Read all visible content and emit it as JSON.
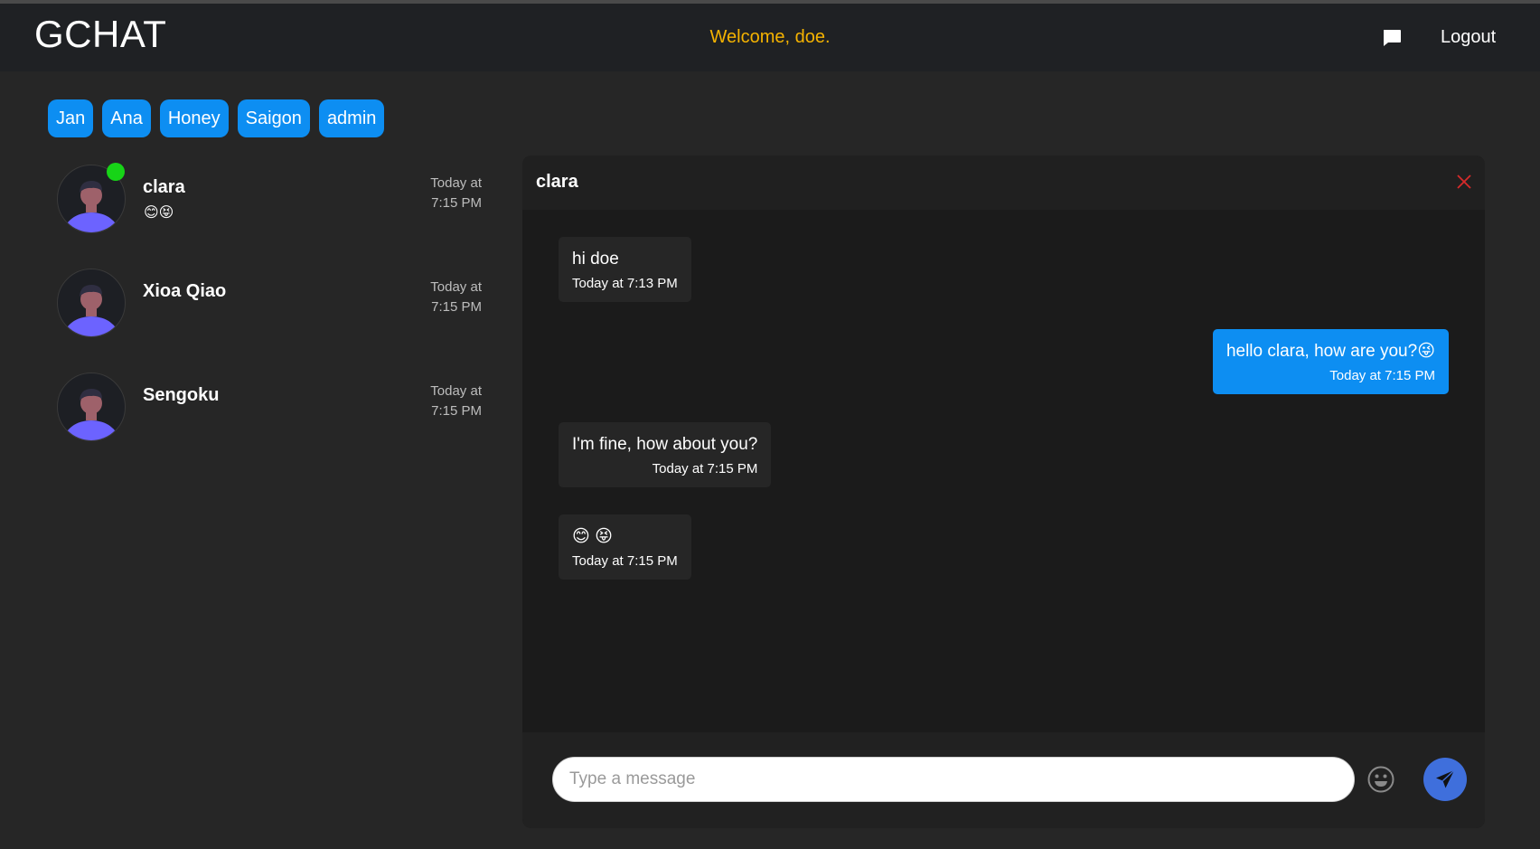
{
  "header": {
    "brand": "GCHAT",
    "welcome": "Welcome, doe.",
    "chat_icon": "chat-bubble-icon",
    "logout_label": "Logout"
  },
  "groups": [
    "Jan",
    "Ana",
    "Honey",
    "Saigon",
    "admin"
  ],
  "conversations": [
    {
      "name": "clara",
      "preview": "😊😝",
      "time": "Today at 7:15 PM",
      "online": true
    },
    {
      "name": "Xioa Qiao",
      "preview": "",
      "time": "Today at 7:15 PM",
      "online": false
    },
    {
      "name": "Sengoku",
      "preview": "",
      "time": "Today at 7:15 PM",
      "online": false
    }
  ],
  "chat": {
    "title": "clara",
    "close_icon": "close-x-icon",
    "messages": [
      {
        "text": "hi doe",
        "time": "Today at 7:13 PM",
        "mine": false
      },
      {
        "text": "hello clara, how are you?😜",
        "time": "Today at 7:15 PM",
        "mine": true
      },
      {
        "text": "I'm fine, how about you?",
        "time": "Today at 7:15 PM",
        "mine": false
      },
      {
        "text": "😊 😝",
        "time": "Today at 7:15 PM",
        "mine": false
      }
    ],
    "composer": {
      "placeholder": "Type a message",
      "emoji_icon": "smiley-icon",
      "send_icon": "paper-plane-icon"
    }
  },
  "colors": {
    "accent_blue": "#0d8ef2",
    "welcome_yellow": "#f5b301",
    "online_green": "#17d417",
    "send_blue": "#3f6fdc",
    "close_red": "#d62a2a"
  }
}
